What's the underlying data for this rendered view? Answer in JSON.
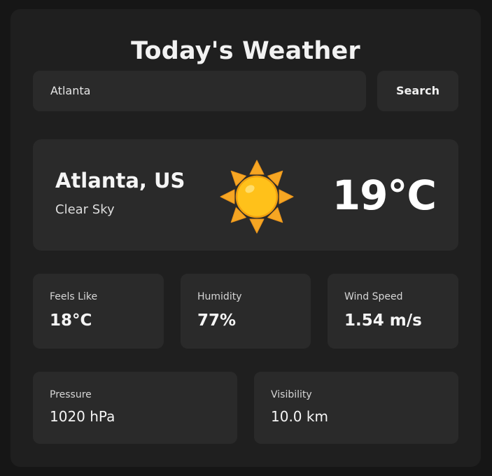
{
  "header": {
    "title": "Today's Weather"
  },
  "search": {
    "value": "Atlanta",
    "button_label": "Search"
  },
  "current": {
    "location": "Atlanta, US",
    "description": "Clear Sky",
    "temperature": "19°C",
    "icon": "sun-icon"
  },
  "details": {
    "feels_like": {
      "label": "Feels Like",
      "value": "18°C"
    },
    "humidity": {
      "label": "Humidity",
      "value": "77%"
    },
    "wind_speed": {
      "label": "Wind Speed",
      "value": "1.54 m/s"
    },
    "pressure": {
      "label": "Pressure",
      "value": "1020 hPa"
    },
    "visibility": {
      "label": "Visibility",
      "value": "10.0 km"
    }
  },
  "colors": {
    "page_background": "#161616",
    "panel_background": "#1f1f1f",
    "card_background": "#2a2a2a",
    "sun_core": "#FFC11A",
    "sun_rays": "#F6A623"
  }
}
